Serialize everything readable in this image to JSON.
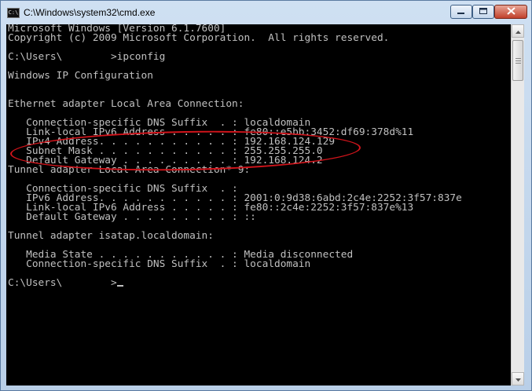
{
  "window": {
    "title": "C:\\Windows\\system32\\cmd.exe",
    "icon_text": "C:\\"
  },
  "console": {
    "lines": [
      "Microsoft Windows [Version 6.1.7600]",
      "Copyright (c) 2009 Microsoft Corporation.  All rights reserved.",
      "",
      "C:\\Users\\        >ipconfig",
      "",
      "Windows IP Configuration",
      "",
      "",
      "Ethernet adapter Local Area Connection:",
      "",
      "   Connection-specific DNS Suffix  . : localdomain",
      "   Link-local IPv6 Address . . . . . : fe80::e5bb:3452:df69:378d%11",
      "   IPv4 Address. . . . . . . . . . . : 192.168.124.129",
      "   Subnet Mask . . . . . . . . . . . : 255.255.255.0",
      "   Default Gateway . . . . . . . . . : 192.168.124.2",
      "Tunnel adapter Local Area Connection* 9:",
      "",
      "   Connection-specific DNS Suffix  . :",
      "   IPv6 Address. . . . . . . . . . . : 2001:0:9d38:6abd:2c4e:2252:3f57:837e",
      "   Link-local IPv6 Address . . . . . : fe80::2c4e:2252:3f57:837e%13",
      "   Default Gateway . . . . . . . . . : ::",
      "",
      "Tunnel adapter isatap.localdomain:",
      "",
      "   Media State . . . . . . . . . . . : Media disconnected",
      "   Connection-specific DNS Suffix  . : localdomain",
      "",
      "C:\\Users\\        >"
    ]
  },
  "colors": {
    "console_bg": "#000000",
    "console_text": "#c0c0c0",
    "annotation_circle": "#d2141b",
    "close_button": "#c1412c"
  },
  "icons": {
    "minimize": "minimize-icon",
    "maximize": "maximize-icon",
    "close": "close-icon",
    "scroll_up": "arrow-up-icon",
    "scroll_down": "arrow-down-icon"
  }
}
